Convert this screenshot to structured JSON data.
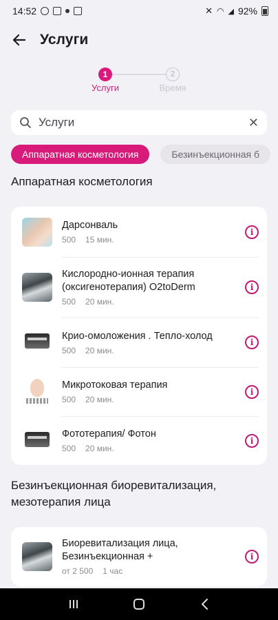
{
  "status_bar": {
    "time": "14:52",
    "battery": "92%"
  },
  "app_bar": {
    "title": "Услуги"
  },
  "stepper": [
    {
      "number": "1",
      "label": "Услуги",
      "active": true
    },
    {
      "number": "2",
      "label": "Время",
      "active": false
    }
  ],
  "search": {
    "placeholder": "Услуги"
  },
  "chips": [
    {
      "label": "Аппаратная косметология",
      "active": true
    },
    {
      "label": "Безинъекционная б",
      "active": false
    }
  ],
  "sections": [
    {
      "title": "Аппаратная косметология",
      "services": [
        {
          "name": "Дарсонваль",
          "price": "500",
          "duration": "15 мин.",
          "image": "face-treatment"
        },
        {
          "name": "Кислородно-ионная терапия (оксигенотерапия) O2toDerm",
          "price": "500",
          "duration": "20 мин.",
          "image": "device-treatment"
        },
        {
          "name": "Крио-омоложения . Тепло-холод",
          "price": "500",
          "duration": "20 мин.",
          "image": "machine"
        },
        {
          "name": "Микротоковая терапия",
          "price": "500",
          "duration": "20 мин.",
          "image": "portrait"
        },
        {
          "name": "Фототерапия/ Фотон",
          "price": "500",
          "duration": "20 мин.",
          "image": "machine"
        }
      ]
    },
    {
      "title": "Безинъекционная биоревитализация, мезотерапия лица",
      "services": [
        {
          "name": "Биоревитализация лица, Безинъекционная +",
          "price": "от 2 500",
          "duration": "1 час",
          "image": "device-treatment"
        }
      ]
    }
  ],
  "colors": {
    "accent": "#d81b7a",
    "background": "#f2f1f6"
  }
}
